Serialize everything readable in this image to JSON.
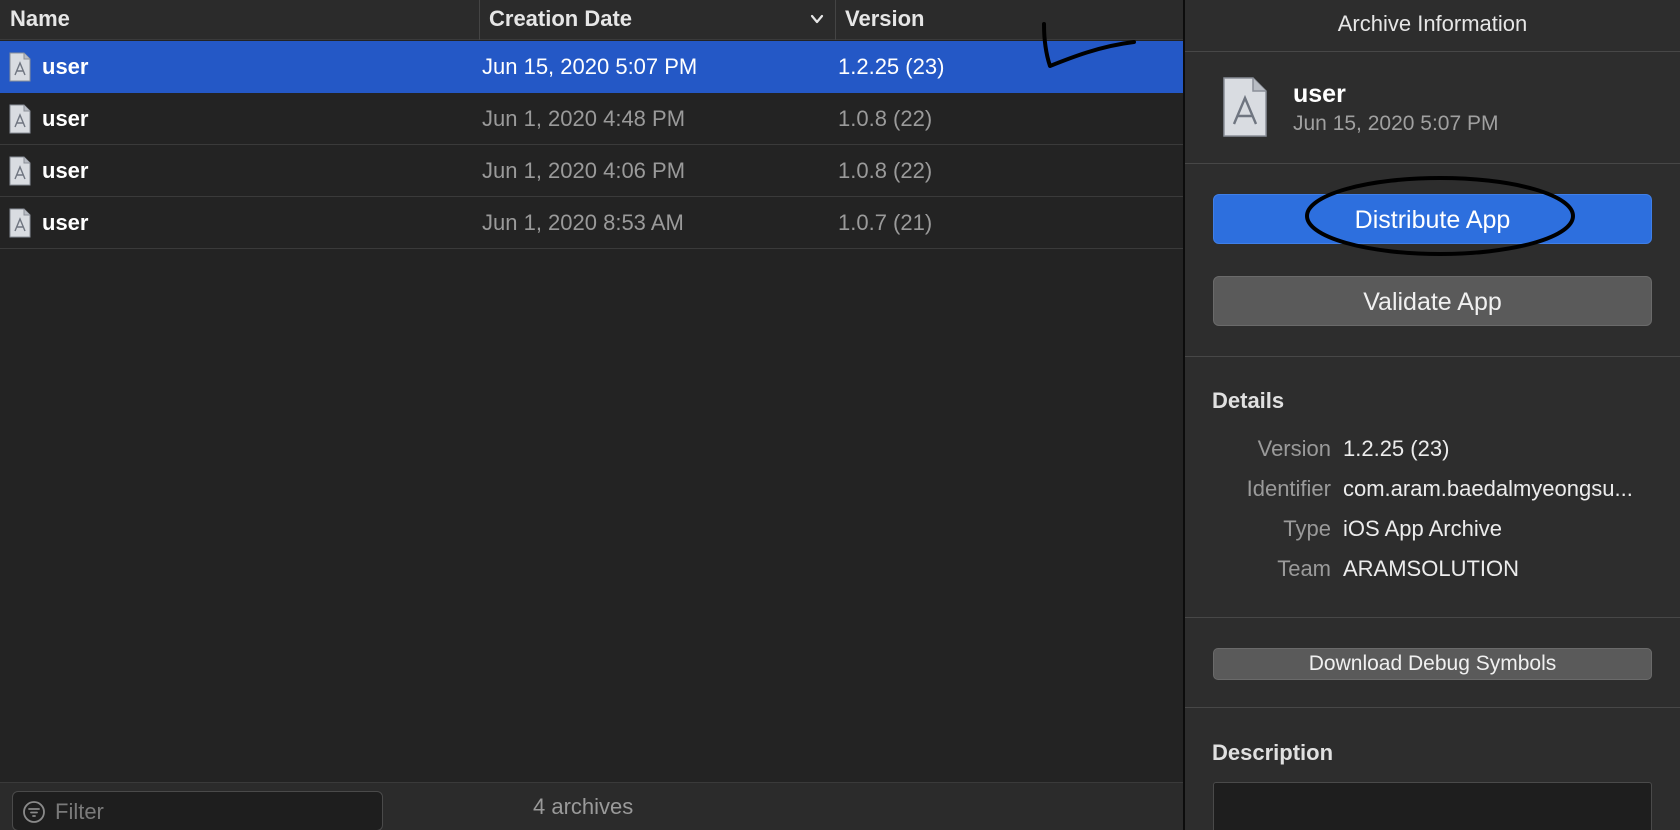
{
  "list": {
    "columns": {
      "name": "Name",
      "date": "Creation Date",
      "version": "Version"
    },
    "rows": [
      {
        "name": "user",
        "date": "Jun 15, 2020 5:07 PM",
        "version": "1.2.25 (23)",
        "selected": true
      },
      {
        "name": "user",
        "date": "Jun 1, 2020 4:48 PM",
        "version": "1.0.8 (22)",
        "selected": false
      },
      {
        "name": "user",
        "date": "Jun 1, 2020 4:06 PM",
        "version": "1.0.8 (22)",
        "selected": false
      },
      {
        "name": "user",
        "date": "Jun 1, 2020 8:53 AM",
        "version": "1.0.7 (21)",
        "selected": false
      }
    ],
    "sort_icon": "chevron-down-icon",
    "file_icon": "app-archive-icon"
  },
  "footer": {
    "filter_placeholder": "Filter",
    "filter_icon": "filter-icon",
    "archive_count": "4 archives"
  },
  "inspector": {
    "title": "Archive Information",
    "archive_name": "user",
    "archive_date": "Jun 15, 2020 5:07 PM",
    "distribute_label": "Distribute App",
    "validate_label": "Validate App",
    "details_heading": "Details",
    "details": {
      "version_label": "Version",
      "version_value": "1.2.25 (23)",
      "identifier_label": "Identifier",
      "identifier_value": "com.aram.baedalmyeongsu...",
      "type_label": "Type",
      "type_value": "iOS App Archive",
      "team_label": "Team",
      "team_value": "ARAMSOLUTION"
    },
    "debug_symbols_label": "Download Debug Symbols",
    "description_heading": "Description"
  },
  "colors": {
    "selection": "#2458c6",
    "primary_button": "#2d6fde",
    "secondary_button": "#5a5a5a",
    "list_background": "#232323",
    "inspector_background": "#2d2d2d"
  }
}
